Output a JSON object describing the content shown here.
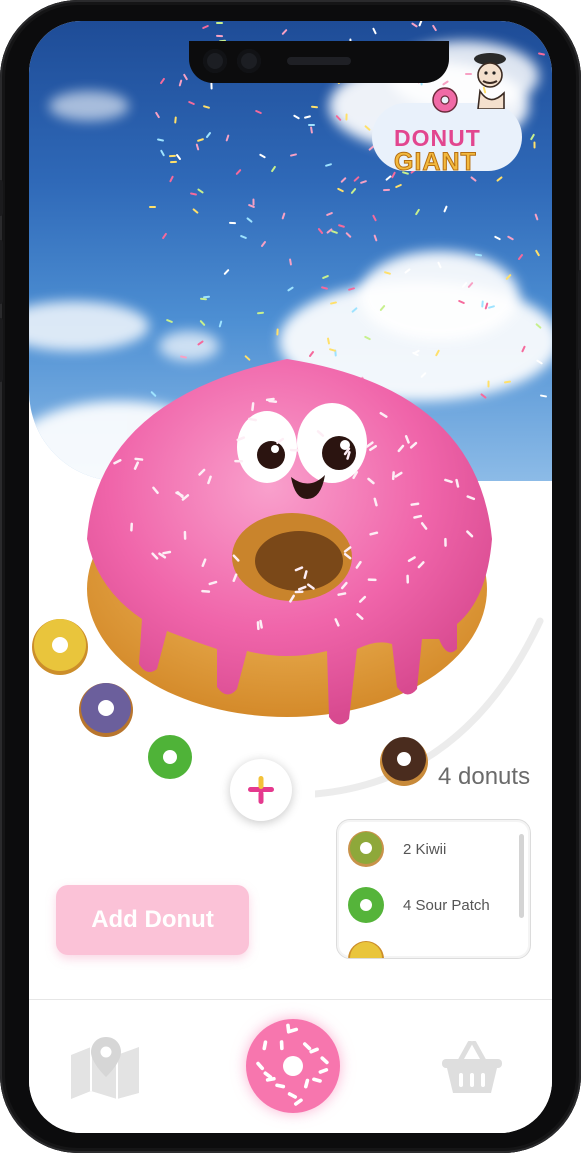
{
  "app": {
    "brand_line1": "DONUT",
    "brand_line2": "GIANT"
  },
  "colors": {
    "accent": "#f776ae",
    "button": "#fbc2d7",
    "text_muted": "#6b6b6b"
  },
  "order": {
    "count_text": "4 donuts",
    "items": [
      {
        "label": "2 Kiwii",
        "icon": "kiwi-donut-icon",
        "color": "#8ea83a"
      },
      {
        "label": "4 Sour Patch",
        "icon": "sour-patch-donut-icon",
        "color": "#55b43a"
      }
    ]
  },
  "flavors": [
    {
      "name": "lemon-donut",
      "color": "#e8c23a"
    },
    {
      "name": "blueberry-donut",
      "color": "#6a5f9b"
    },
    {
      "name": "sour-patch-donut",
      "color": "#4fb338"
    },
    {
      "name": "chocolate-donut",
      "color": "#4a2c1e"
    }
  ],
  "actions": {
    "add_label": "Add Donut"
  },
  "nav": {
    "items": [
      {
        "icon": "map-pin-icon"
      },
      {
        "icon": "donut-icon"
      },
      {
        "icon": "basket-icon"
      }
    ]
  }
}
